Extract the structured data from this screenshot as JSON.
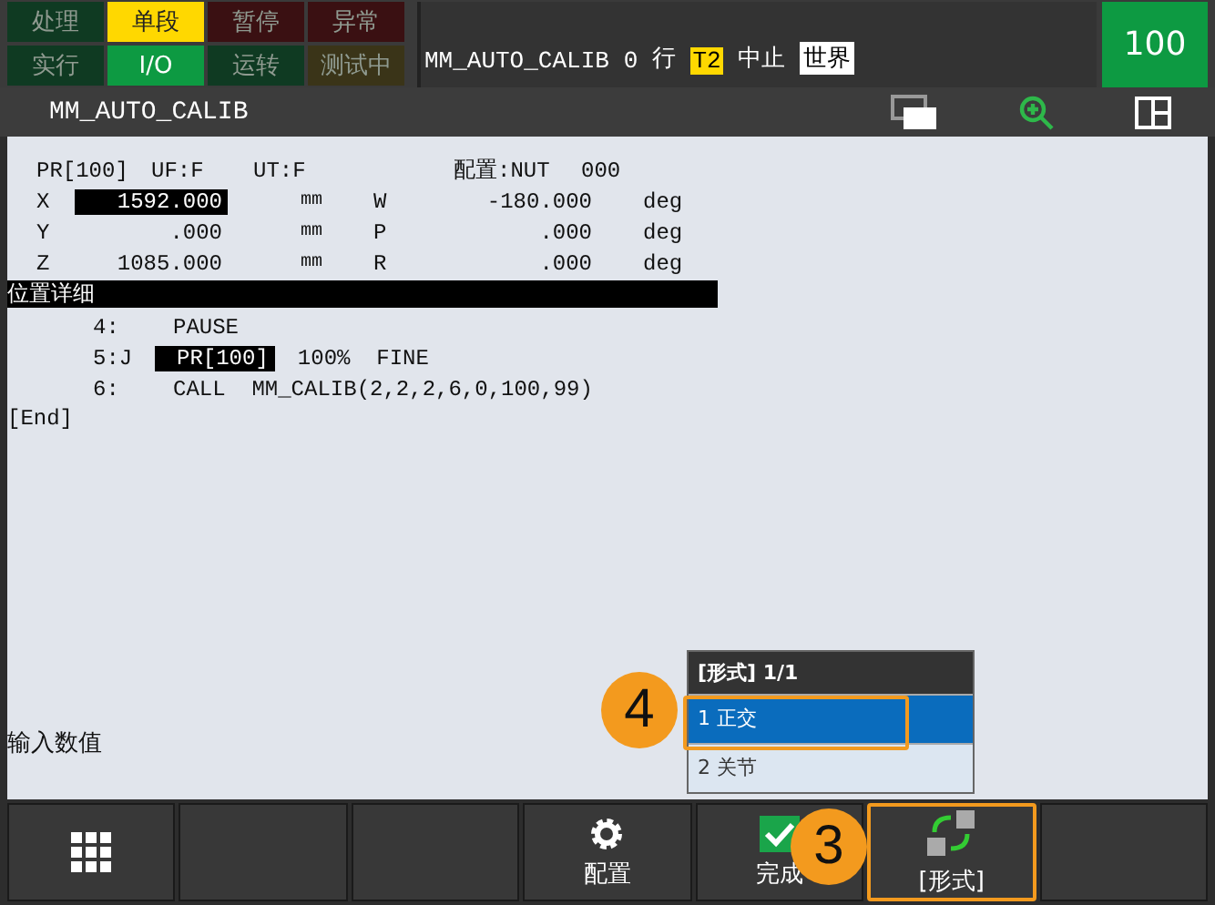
{
  "status_tiles": [
    {
      "label": "处理",
      "on": false,
      "color": "#0f3a22"
    },
    {
      "label": "单段",
      "on": true,
      "color": "#ffd800"
    },
    {
      "label": "暂停",
      "on": false,
      "color": "#3a1012"
    },
    {
      "label": "异常",
      "on": false,
      "color": "#3a1012"
    },
    {
      "label": "实行",
      "on": false,
      "color": "#0f3a22"
    },
    {
      "label": "I/O",
      "on": true,
      "color": "#0d9a42"
    },
    {
      "label": "运转",
      "on": false,
      "color": "#0f3a22"
    },
    {
      "label": "测试中",
      "on": false,
      "color": "#3a3418"
    }
  ],
  "status_line": {
    "program": "MM_AUTO_CALIB",
    "line": "0",
    "line_label": "行",
    "mode": "T2",
    "state": "中止",
    "frame": "世界"
  },
  "override": "100",
  "title": "MM_AUTO_CALIB",
  "position": {
    "header": [
      "PR[100]",
      "UF:F",
      "UT:F",
      "配置:NUT",
      "000"
    ],
    "rows": [
      {
        "axis": "X",
        "value": "1592.000",
        "unit": "mm",
        "axis2": "W",
        "value2": "-180.000",
        "unit2": "deg",
        "selected": true
      },
      {
        "axis": "Y",
        "value": ".000",
        "unit": "mm",
        "axis2": "P",
        "value2": ".000",
        "unit2": "deg",
        "selected": false
      },
      {
        "axis": "Z",
        "value": "1085.000",
        "unit": "mm",
        "axis2": "R",
        "value2": ".000",
        "unit2": "deg",
        "selected": false
      }
    ]
  },
  "section": "位置详细",
  "program_lines": [
    {
      "number": "4:",
      "operand": "PAUSE",
      "operand_selected": false
    },
    {
      "number": "5:J",
      "operand": "PR[100]",
      "operand_selected": true,
      "rest": "100%  FINE"
    },
    {
      "number": "6:",
      "operand": "CALL  MM_CALIB(2,2,2,6,0,100,99)",
      "operand_selected": false
    }
  ],
  "end_marker": "[End]",
  "prompt": "输入数值",
  "popup": {
    "title": "[形式] 1/1",
    "items": [
      {
        "label": "1 正交",
        "selected": true,
        "highlighted": true
      },
      {
        "label": "2 关节",
        "selected": false,
        "highlighted": false
      }
    ]
  },
  "function_keys": [
    {
      "kind": "menu",
      "highlighted": false
    },
    {
      "kind": "empty",
      "highlighted": false
    },
    {
      "kind": "empty",
      "highlighted": false
    },
    {
      "kind": "gear",
      "label": "配置",
      "highlighted": false
    },
    {
      "kind": "check",
      "label": "完成",
      "highlighted": false
    },
    {
      "kind": "frames",
      "label": "[形式]",
      "highlighted": true
    },
    {
      "kind": "empty",
      "highlighted": false
    }
  ],
  "callouts": [
    {
      "label": "4"
    },
    {
      "label": "3"
    }
  ]
}
